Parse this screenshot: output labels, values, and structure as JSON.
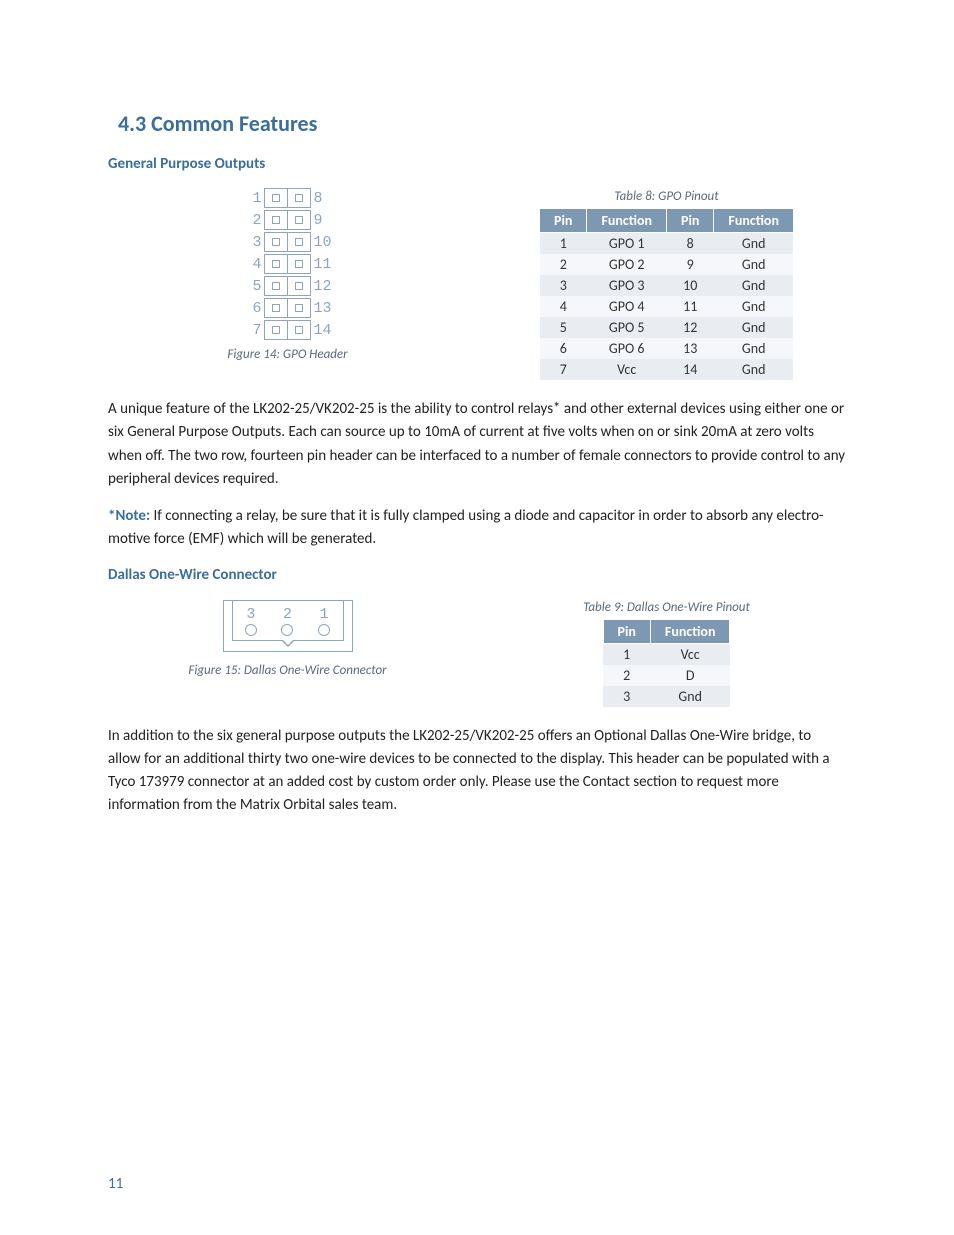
{
  "section_title": "4.3 Common Features",
  "gpo": {
    "heading": "General Purpose Outputs",
    "figure_caption": "Figure 14: GPO Header",
    "table_caption": "Table 8: GPO Pinout",
    "diagram_left": [
      "1",
      "2",
      "3",
      "4",
      "5",
      "6",
      "7"
    ],
    "diagram_right": [
      "8",
      "9",
      "10",
      "11",
      "12",
      "13",
      "14"
    ],
    "headers": [
      "Pin",
      "Function",
      "Pin",
      "Function"
    ],
    "rows": [
      [
        "1",
        "GPO 1",
        "8",
        "Gnd"
      ],
      [
        "2",
        "GPO 2",
        "9",
        "Gnd"
      ],
      [
        "3",
        "GPO 3",
        "10",
        "Gnd"
      ],
      [
        "4",
        "GPO 4",
        "11",
        "Gnd"
      ],
      [
        "5",
        "GPO 5",
        "12",
        "Gnd"
      ],
      [
        "6",
        "GPO 6",
        "13",
        "Gnd"
      ],
      [
        "7",
        "Vcc",
        "14",
        "Gnd"
      ]
    ],
    "para": "A unique feature of the LK202-25/VK202-25 is the ability to control relays* and other external devices using either one or six General Purpose Outputs.  Each can source up to 10mA of current at five volts when on or sink 20mA at zero volts when off.  The two row, fourteen pin header can be interfaced to a number of female connectors to provide control to any peripheral devices required.",
    "note_label": "*Note:",
    "note_text": " If connecting a relay, be sure that it is fully clamped using a diode and capacitor in order to absorb any electro-motive force (EMF) which will be generated."
  },
  "dallas": {
    "heading": "Dallas One-Wire Connector",
    "figure_caption": "Figure 15: Dallas One-Wire Connector",
    "table_caption": "Table 9: Dallas One-Wire Pinout",
    "diagram_labels": [
      "3",
      "2",
      "1"
    ],
    "headers": [
      "Pin",
      "Function"
    ],
    "rows": [
      [
        "1",
        "Vcc"
      ],
      [
        "2",
        "D"
      ],
      [
        "3",
        "Gnd"
      ]
    ],
    "para": "In addition to the six general purpose outputs the LK202-25/VK202-25 offers an Optional Dallas One-Wire bridge, to allow for an additional thirty two one-wire devices to be connected to the display.  This header can be populated with a Tyco 173979 connector at an added cost by custom order only.  Please use the Contact section to request more information from the Matrix Orbital sales team."
  },
  "page_number": "11"
}
